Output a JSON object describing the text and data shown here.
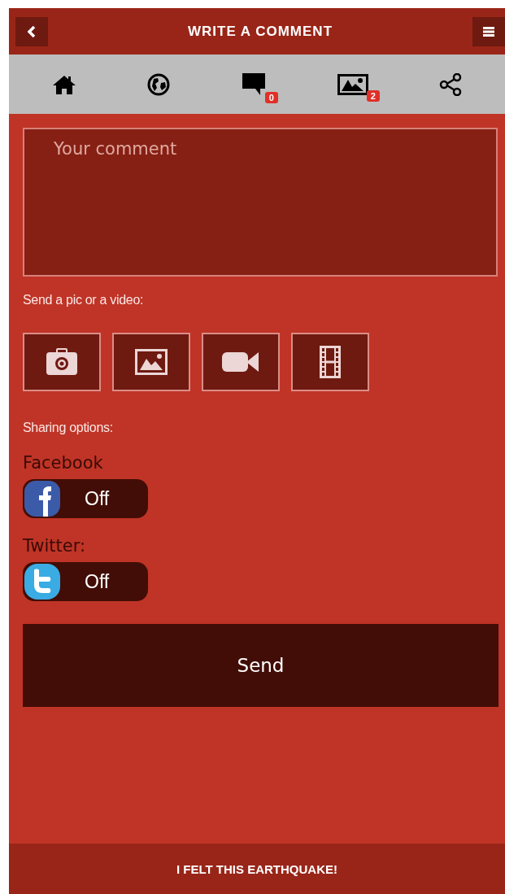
{
  "header": {
    "title": "WRITE A COMMENT"
  },
  "nav": [
    {
      "kind": "home"
    },
    {
      "kind": "globe"
    },
    {
      "kind": "comments",
      "badge": "0"
    },
    {
      "kind": "photos",
      "badge": "2"
    },
    {
      "kind": "share"
    }
  ],
  "comment": {
    "placeholder": "Your comment"
  },
  "media_label": "Send a pic or a video:",
  "media": [
    {
      "kind": "camera"
    },
    {
      "kind": "gallery"
    },
    {
      "kind": "video"
    },
    {
      "kind": "film"
    }
  ],
  "sharing_label": "Sharing options:",
  "sharing": [
    {
      "kind": "facebook",
      "label": "Facebook",
      "state": "Off",
      "on": false
    },
    {
      "kind": "twitter",
      "label": "Twitter:",
      "state": "Off",
      "on": false
    }
  ],
  "send": "Send",
  "footer": "I FELT THIS EARTHQUAKE!"
}
